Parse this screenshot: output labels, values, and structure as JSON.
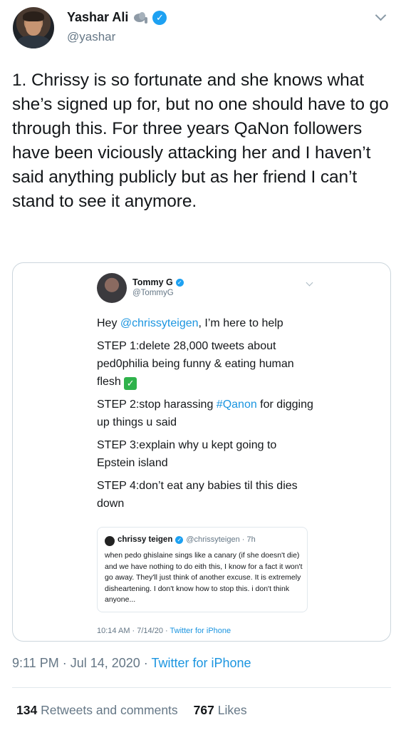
{
  "author": {
    "display_name": "Yashar Ali",
    "handle": "@yashar"
  },
  "tweet": {
    "text": "1. Chrissy is so fortunate and she knows what she’s signed up for, but no one should have to go through this. For three years QaNon followers have been viciously attacking her and I haven’t said anything publicly but as her friend I can’t stand to see it anymore.",
    "timestamp": "9:11 PM · Jul 14, 2020 · ",
    "source": "Twitter for iPhone"
  },
  "embedded": {
    "display_name": "Tommy G",
    "handle": "@TommyG",
    "line1_prefix": "Hey ",
    "line1_mention": "@chrissyteigen",
    "line1_suffix": ", I’m here to help",
    "step1": "STEP 1:delete 28,000 tweets about ped0philia being funny & eating human flesh",
    "step2_prefix": "STEP 2:stop harassing ",
    "step2_hashtag": "#Qanon",
    "step2_suffix": " for digging up things u said",
    "step3": "STEP 3:explain why u kept going to Epstein island",
    "step4": "STEP 4:don’t eat any babies til this dies down",
    "footer_time": "10:14 AM · 7/14/20 · ",
    "footer_source": "Twitter for iPhone",
    "quote": {
      "name": "chrissy teigen",
      "meta": "@chrissyteigen · 7h",
      "text": "when pedo ghislaine sings like a canary (if she doesn't die) and we have nothing to do eith this, I know for a fact it won't go away. They'll just think of another excuse. It is extremely disheartening. I don't know how to stop this. i don't think anyone..."
    }
  },
  "stats": {
    "retweets_count": "134",
    "retweets_label": "Retweets and comments",
    "likes_count": "767",
    "likes_label": "Likes"
  },
  "icons": [
    "elephant-emoji-icon",
    "verified-badge-icon",
    "chevron-down-icon",
    "check-mark-emoji-icon"
  ],
  "colors": {
    "link": "#1b95e0",
    "verified": "#1da1f2",
    "muted": "#657786"
  }
}
